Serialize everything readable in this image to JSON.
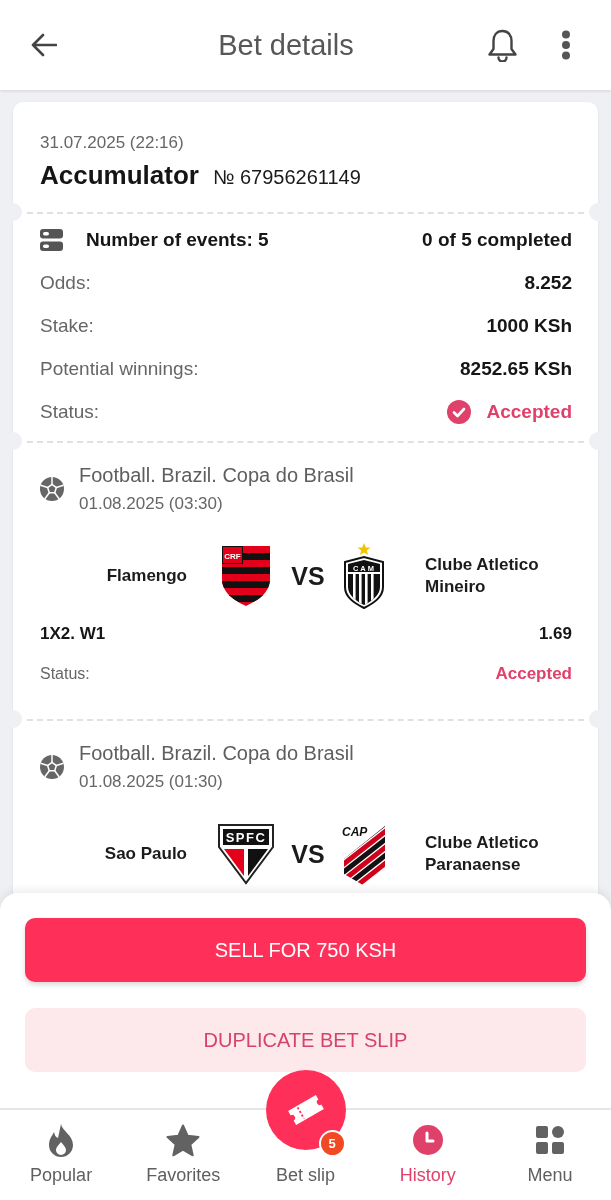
{
  "header": {
    "title": "Bet details"
  },
  "bet": {
    "date": "31.07.2025 (22:16)",
    "type": "Accumulator",
    "number": "№ 67956261149"
  },
  "summary": {
    "events": "Number of events: 5",
    "completed": "0 of 5 completed",
    "rows": [
      {
        "label": "Odds:",
        "value": "8.252",
        "kind": "plain"
      },
      {
        "label": "Stake:",
        "value": "1000 KSh",
        "kind": "plain"
      },
      {
        "label": "Potential winnings:",
        "value": "8252.65 KSh",
        "kind": "plain"
      },
      {
        "label": "Status:",
        "value": "Accepted",
        "kind": "status"
      }
    ]
  },
  "events": [
    {
      "league": "Football. Brazil. Copa do Brasil",
      "date": "01.08.2025 (03:30)",
      "home": {
        "name": "Flamengo",
        "crest_text": "CRF"
      },
      "vs": "VS",
      "away": {
        "name": "Clube Atletico Mineiro",
        "crest_text": "CAM"
      },
      "market": "1X2. W1",
      "odds": "1.69",
      "status_label": "Status:",
      "status": "Accepted"
    },
    {
      "league": "Football. Brazil. Copa do Brasil",
      "date": "01.08.2025 (01:30)",
      "home": {
        "name": "Sao Paulo",
        "crest_text": "SPFC"
      },
      "vs": "VS",
      "away": {
        "name": "Clube Atletico Paranaense",
        "crest_text": "CAP"
      }
    }
  ],
  "actions": [
    {
      "label": "SELL FOR 750 KSH",
      "kind": "primary"
    },
    {
      "label": "DUPLICATE BET SLIP",
      "kind": "secondary"
    }
  ],
  "nav": [
    {
      "label": "Popular",
      "kind": "tab",
      "selected": false
    },
    {
      "label": "Favorites",
      "kind": "tab",
      "selected": false
    },
    {
      "label": "Bet slip",
      "kind": "center",
      "selected": false,
      "badge": "5"
    },
    {
      "label": "History",
      "kind": "tab",
      "selected": true
    },
    {
      "label": "Menu",
      "kind": "tab",
      "selected": false
    }
  ]
}
